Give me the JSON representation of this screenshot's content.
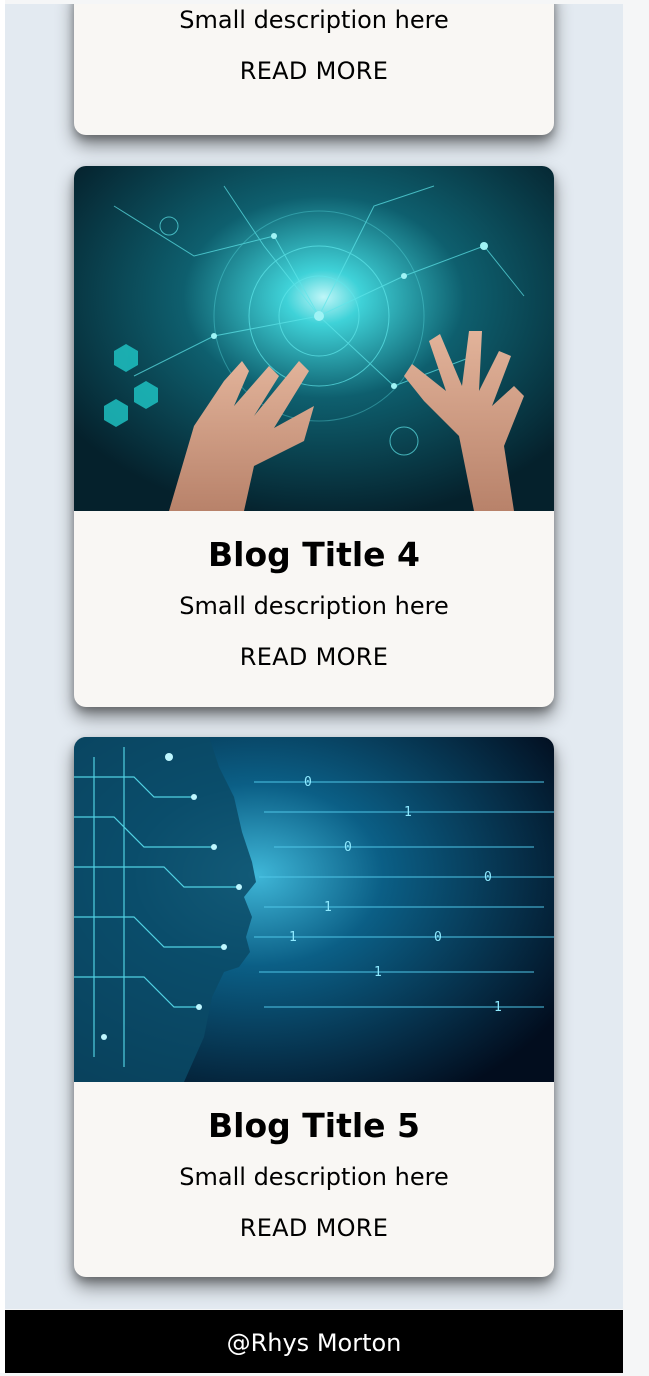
{
  "cards": [
    {
      "description": "Small description here",
      "link": "READ MORE"
    },
    {
      "title": "Blog Title 4",
      "description": "Small description here",
      "link": "READ MORE",
      "image": "tech-hands-network-image"
    },
    {
      "title": "Blog Title 5",
      "description": "Small description here",
      "link": "READ MORE",
      "image": "ai-circuit-head-image"
    }
  ],
  "footer": {
    "text": "@Rhys Morton"
  },
  "colors": {
    "page_background": "#e3eaf1",
    "card_background": "#f9f7f4",
    "footer_background": "#000000",
    "footer_text": "#ffffff"
  }
}
